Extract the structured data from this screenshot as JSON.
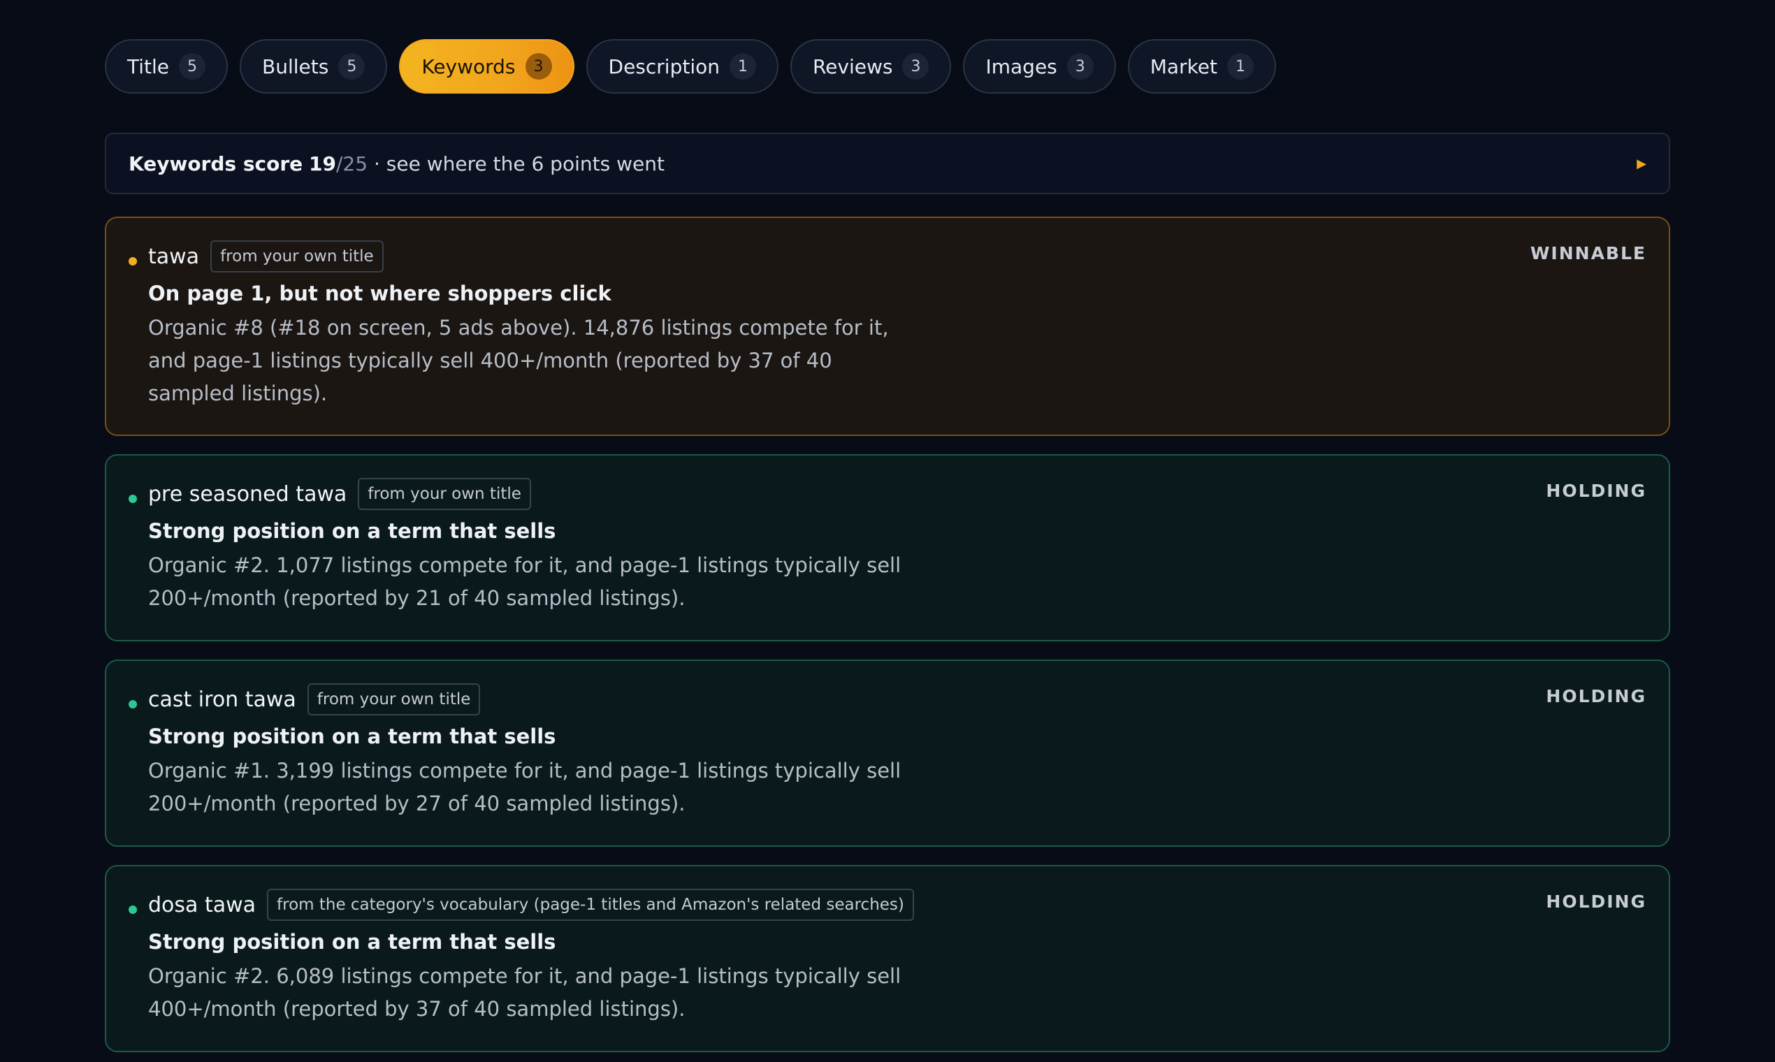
{
  "tabs": [
    {
      "label": "Title",
      "count": "5"
    },
    {
      "label": "Bullets",
      "count": "5"
    },
    {
      "label": "Keywords",
      "count": "3",
      "active": true
    },
    {
      "label": "Description",
      "count": "1"
    },
    {
      "label": "Reviews",
      "count": "3"
    },
    {
      "label": "Images",
      "count": "3"
    },
    {
      "label": "Market",
      "count": "1"
    }
  ],
  "score": {
    "label": "Keywords score",
    "value": "19",
    "denominator": "/25",
    "detail": "· see where the 6 points went",
    "arrow_icon": "play-triangle-icon"
  },
  "colors": {
    "accent": "#f2a51d",
    "winnable_dot": "#f2b021",
    "holding_dot": "#2cc994"
  },
  "keywords": [
    {
      "keyword": "tawa",
      "source": "from your own title",
      "status": "WINNABLE",
      "headline": "On page 1, but not where shoppers click",
      "detail": "Organic #8 (#18 on screen, 5 ads above). 14,876 listings compete for it, and page-1 listings typically sell 400+/month (reported by 37 of 40 sampled listings)."
    },
    {
      "keyword": "pre seasoned tawa",
      "source": "from your own title",
      "status": "HOLDING",
      "headline": "Strong position on a term that sells",
      "detail": "Organic #2. 1,077 listings compete for it, and page-1 listings typically sell 200+/month (reported by 21 of 40 sampled listings)."
    },
    {
      "keyword": "cast iron tawa",
      "source": "from your own title",
      "status": "HOLDING",
      "headline": "Strong position on a term that sells",
      "detail": "Organic #1. 3,199 listings compete for it, and page-1 listings typically sell 200+/month (reported by 27 of 40 sampled listings)."
    },
    {
      "keyword": "dosa tawa",
      "source": "from the category's vocabulary (page-1 titles and Amazon's related searches)",
      "status": "HOLDING",
      "headline": "Strong position on a term that sells",
      "detail": "Organic #2. 6,089 listings compete for it, and page-1 listings typically sell 400+/month (reported by 37 of 40 sampled listings)."
    }
  ]
}
